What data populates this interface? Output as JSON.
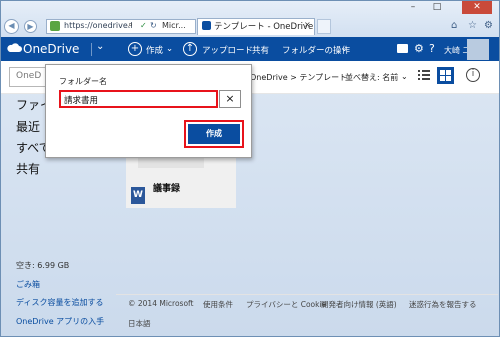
{
  "browser": {
    "address_url": "https://onedrive.l",
    "address_extra": "Micr...",
    "tab_title": "テンプレート - OneDrive",
    "tab_close": "×"
  },
  "appbar": {
    "brand": "OneDrive",
    "create_label": "作成",
    "upload_label": "アップロード",
    "share_label": "共有",
    "folder_ops_label": "フォルダーの操作",
    "user_name": "大崎 二郎"
  },
  "subbar": {
    "search_placeholder": "OneD",
    "breadcrumb": "OneDrive > テンプレート",
    "sort_label": "並べ替え: 名前"
  },
  "sidebar": {
    "items": [
      {
        "label": "ファイル"
      },
      {
        "label": "最近"
      },
      {
        "label": "すべて"
      },
      {
        "label": "共有"
      }
    ],
    "storage_free": "空き: 6.99 GB",
    "recycle_bin": "ごみ箱",
    "add_storage": "ディスク容量を追加する",
    "get_app": "OneDrive アプリの入手"
  },
  "content": {
    "items": [
      {
        "name": "議事録",
        "type": "word"
      }
    ]
  },
  "footer": {
    "copyright": "© 2014 Microsoft",
    "links": [
      "使用条件",
      "プライバシーと Cookie",
      "開発者向け情報 (英語)",
      "迷惑行為を報告する"
    ],
    "language": "日本語"
  },
  "dialog": {
    "label": "フォルダー名",
    "input_value": "請求書用",
    "clear_symbol": "×",
    "create_button": "作成"
  },
  "colors": {
    "brand_blue": "#0a4da0",
    "highlight_red": "#e8131b"
  },
  "icons": [
    "back-icon",
    "forward-icon",
    "search-icon",
    "refresh-icon",
    "cloud-icon",
    "plus-icon",
    "upload-icon",
    "chat-icon",
    "gear-icon",
    "list-view-icon",
    "grid-view-icon",
    "info-icon",
    "word-doc-icon",
    "home-icon",
    "star-icon"
  ]
}
